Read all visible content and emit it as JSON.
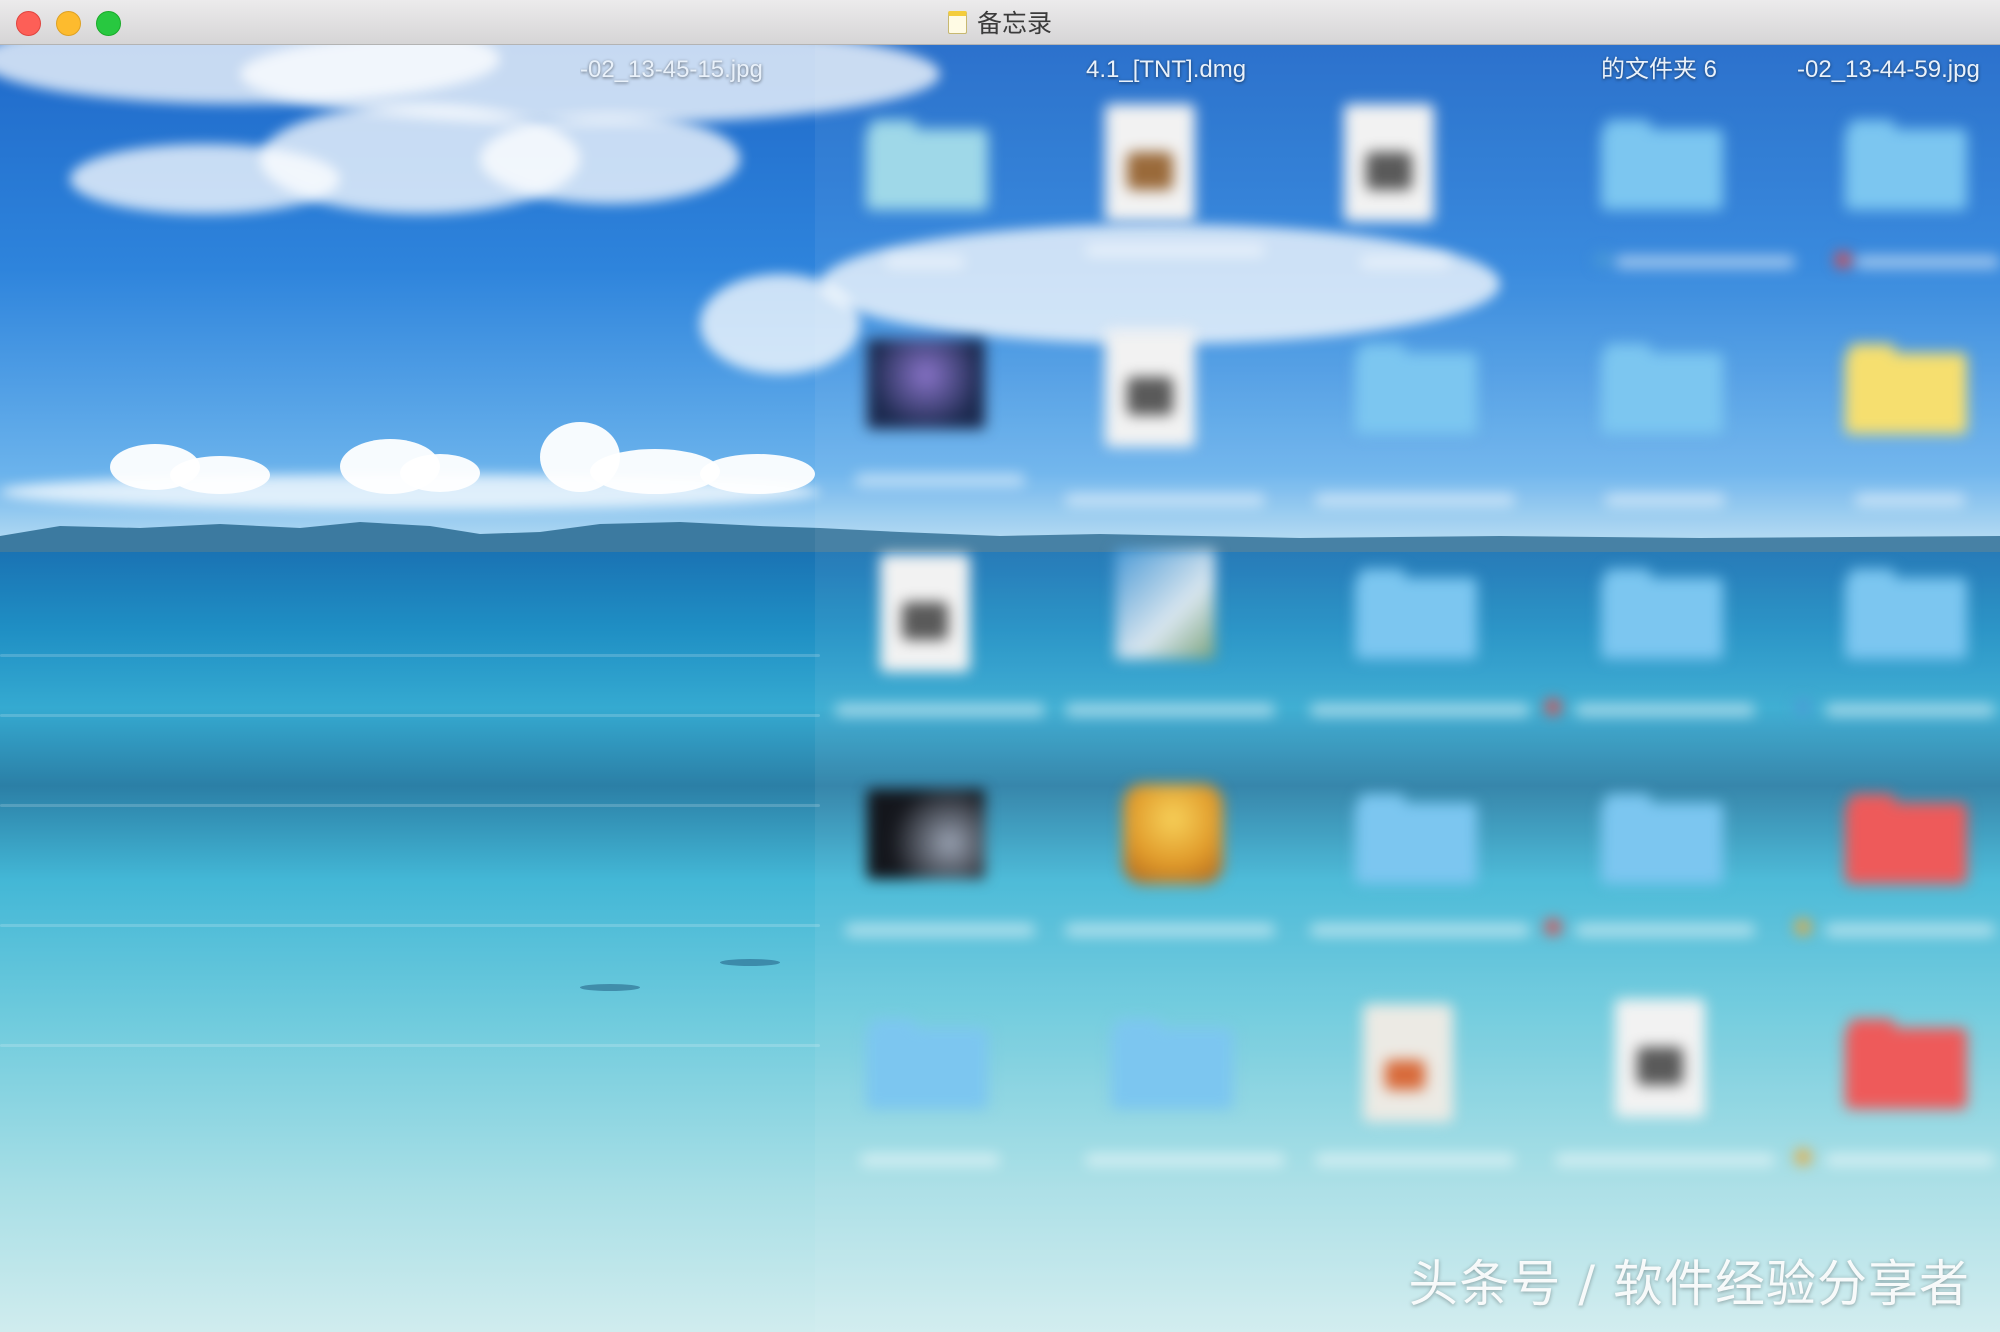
{
  "window": {
    "title": "备忘录",
    "traffic_lights": {
      "close": "#fd5f57",
      "minimize": "#fdbb2e",
      "zoom": "#28c840"
    }
  },
  "desktop": {
    "visible_filenames": [
      "-02_13-45-15.jpg",
      "4.1_[TNT].dmg",
      "的文件夹 6",
      "-02_13-44-59.jpg"
    ],
    "icons": [
      {
        "type": "folder",
        "color": "#9fd8e8"
      },
      {
        "type": "disk-image-doc",
        "color": "#f2f2f2"
      },
      {
        "type": "disk-image-doc",
        "color": "#f2f2f2"
      },
      {
        "type": "folder",
        "color": "#7cc6f0"
      },
      {
        "type": "folder",
        "color": "#7cc6f0"
      },
      {
        "type": "image-file",
        "color": "#1c2a4f"
      },
      {
        "type": "disk-image-doc",
        "color": "#f2f2f2"
      },
      {
        "type": "folder",
        "color": "#7cc6f0"
      },
      {
        "type": "folder",
        "color": "#7cc6f0"
      },
      {
        "type": "folder",
        "color": "#f6df6f"
      },
      {
        "type": "disk-image-doc",
        "color": "#f2f2f2"
      },
      {
        "type": "installer-app",
        "color": "#4b9ad6"
      },
      {
        "type": "folder",
        "color": "#7cc6f0"
      },
      {
        "type": "folder",
        "color": "#7cc6f0"
      },
      {
        "type": "folder",
        "color": "#7cc6f0"
      },
      {
        "type": "image-file",
        "color": "#14161c"
      },
      {
        "type": "package-icon",
        "color": "#e8a93a"
      },
      {
        "type": "folder",
        "color": "#7cc6f0"
      },
      {
        "type": "folder",
        "color": "#7cc6f0"
      },
      {
        "type": "folder",
        "color": "#ee5a5a"
      },
      {
        "type": "folder",
        "color": "#7cc6f0"
      },
      {
        "type": "folder",
        "color": "#7cc6f0"
      },
      {
        "type": "document-file",
        "color": "#f2f2f2"
      },
      {
        "type": "disk-image-doc",
        "color": "#f2f2f2"
      },
      {
        "type": "folder",
        "color": "#ee5a5a"
      }
    ]
  },
  "watermark": "头条号 / 软件经验分享者"
}
